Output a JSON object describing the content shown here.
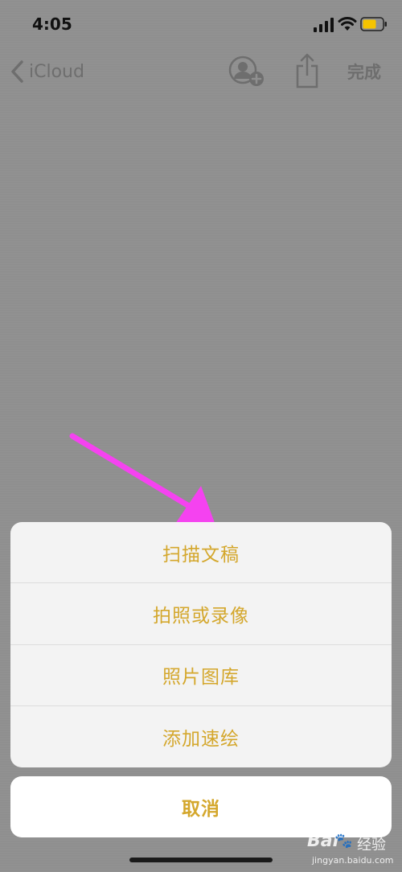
{
  "status_bar": {
    "time": "4:05",
    "signal_icon": "cellular-signal-icon",
    "wifi_icon": "wifi-icon",
    "battery_icon": "battery-icon",
    "battery_color": "#f5c400"
  },
  "nav": {
    "back_label": "iCloud",
    "add_person_icon": "add-person-icon",
    "share_icon": "share-icon",
    "done_label": "完成"
  },
  "action_sheet": {
    "items": [
      {
        "label": "扫描文稿"
      },
      {
        "label": "拍照或录像"
      },
      {
        "label": "照片图库"
      },
      {
        "label": "添加速绘"
      }
    ],
    "cancel_label": "取消"
  },
  "annotation": {
    "arrow_color": "#f542f0"
  },
  "watermark": {
    "brand": "Bai",
    "brand_suffix": "经验",
    "url": "jingyan.baidu.com"
  },
  "colors": {
    "accent": "#d4a72c",
    "background": "#8f8f8f"
  }
}
